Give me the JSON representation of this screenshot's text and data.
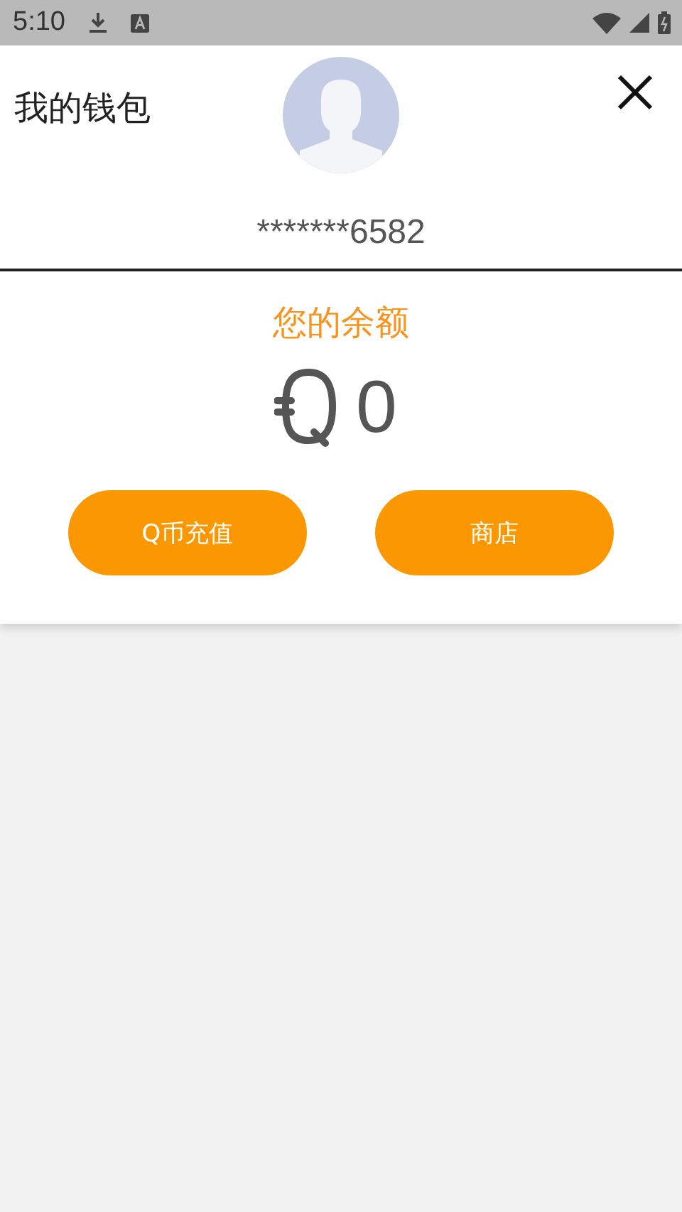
{
  "status_bar": {
    "time": "5:10"
  },
  "header": {
    "title": "我的钱包",
    "account": "*******6582"
  },
  "balance": {
    "label": "您的余额",
    "amount": "0"
  },
  "buttons": [
    {
      "label": "Q币充值"
    },
    {
      "label": "商店"
    }
  ]
}
